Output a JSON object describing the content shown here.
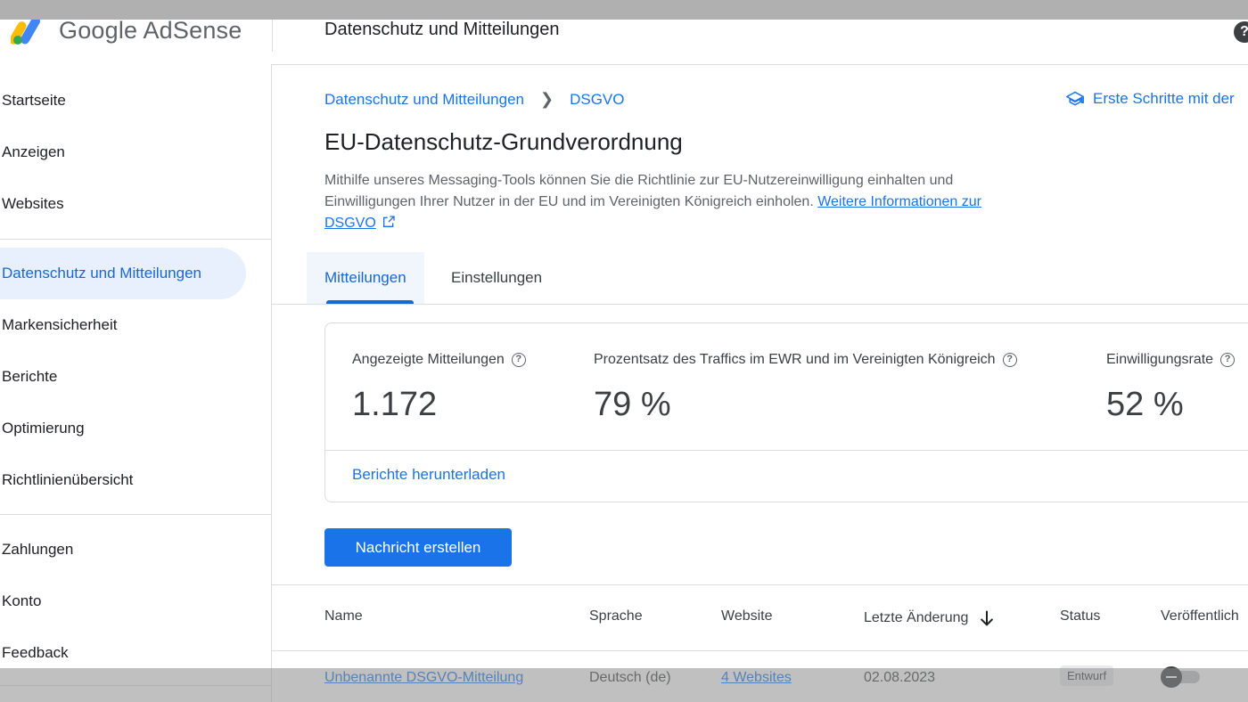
{
  "header": {
    "logo_text": "Google AdSense",
    "title": "Datenschutz und Mitteilungen",
    "help_icon": "help-icon"
  },
  "sidebar": {
    "items": [
      {
        "label": "Startseite"
      },
      {
        "label": "Anzeigen"
      },
      {
        "label": "Websites"
      },
      {
        "label": "Datenschutz und Mitteilungen",
        "active": true
      },
      {
        "label": "Markensicherheit"
      },
      {
        "label": "Berichte"
      },
      {
        "label": "Optimierung"
      },
      {
        "label": "Richtlinienübersicht"
      },
      {
        "label": "Zahlungen"
      },
      {
        "label": "Konto"
      },
      {
        "label": "Feedback"
      }
    ]
  },
  "breadcrumb": {
    "parent": "Datenschutz und Mitteilungen",
    "current": "DSGVO"
  },
  "get_started": "Erste Schritte mit der",
  "page_title": "EU-Datenschutz-Grundverordnung",
  "description": {
    "text": "Mithilfe unseres Messaging-Tools können Sie die Richtlinie zur EU-Nutzereinwilligung einhalten und Einwilligungen Ihrer Nutzer in der EU und im Vereinigten Königreich einholen. ",
    "link": "Weitere Informationen zur DSGVO"
  },
  "tabs": [
    {
      "label": "Mitteilungen",
      "active": true
    },
    {
      "label": "Einstellungen",
      "active": false
    }
  ],
  "stats": [
    {
      "label": "Angezeigte Mitteilungen",
      "value": "1.172"
    },
    {
      "label": "Prozentsatz des Traffics im EWR und im Vereinigten Königreich",
      "value": "79 %"
    },
    {
      "label": "Einwilligungsrate",
      "value": "52 %"
    }
  ],
  "card_link": "Berichte herunterladen",
  "create_button": "Nachricht erstellen",
  "table": {
    "headers": [
      "Name",
      "Sprache",
      "Website",
      "Letzte Änderung",
      "Status",
      "Veröffentlich"
    ],
    "rows": [
      {
        "name": "Unbenannte DSGVO-Mitteilung",
        "language": "Deutsch (de)",
        "website": "4 Websites",
        "modified": "02.08.2023",
        "status": "Entwurf"
      }
    ]
  },
  "colors": {
    "accent": "#1a73e8",
    "active_nav_bg": "#e8f0fe"
  }
}
